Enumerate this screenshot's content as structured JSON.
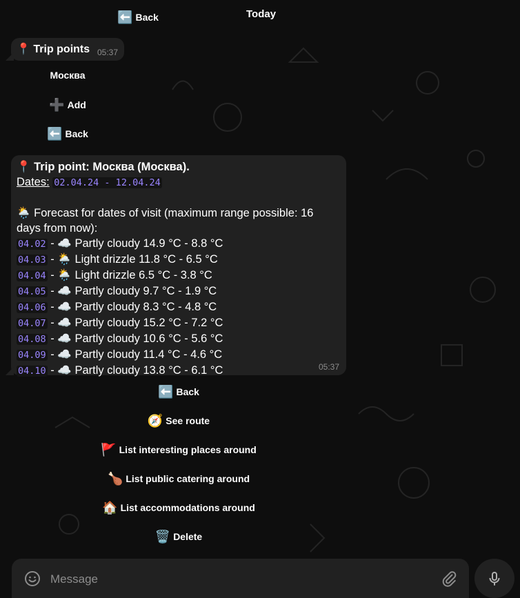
{
  "header": {
    "back_label": "Back",
    "date": "Today"
  },
  "trip_points_msg": {
    "title": "Trip points",
    "time": "05:37"
  },
  "menu1": {
    "city_label": "Москва",
    "add_label": "Add",
    "back_label": "Back"
  },
  "forecast_msg": {
    "line1": "Trip point: Москва (Москва).",
    "dates_label": "Dates:",
    "dates_value": "02.04.24 - 12.04.24",
    "forecast_line1": "Forecast for dates of visit (maximum range possible: 16",
    "forecast_line2": "days from now):",
    "rows": [
      {
        "date": "04.02",
        "icon": "cloud-icon",
        "text": "Partly cloudy 14.9 °C - 8.8 °C"
      },
      {
        "date": "04.03",
        "icon": "rain-cloud-icon",
        "text": "Light drizzle 11.8 °C - 6.5 °C"
      },
      {
        "date": "04.04",
        "icon": "rain-cloud-icon",
        "text": "Light drizzle 6.5 °C - 3.8 °C"
      },
      {
        "date": "04.05",
        "icon": "cloud-icon",
        "text": "Partly cloudy 9.7 °C - 1.9 °C"
      },
      {
        "date": "04.06",
        "icon": "cloud-icon",
        "text": "Partly cloudy 8.3 °C - 4.8 °C"
      },
      {
        "date": "04.07",
        "icon": "cloud-icon",
        "text": "Partly cloudy 15.2 °C - 7.2 °C"
      },
      {
        "date": "04.08",
        "icon": "cloud-icon",
        "text": "Partly cloudy 10.6 °C - 5.6 °C"
      },
      {
        "date": "04.09",
        "icon": "cloud-icon",
        "text": "Partly cloudy 11.4 °C - 4.6 °C"
      },
      {
        "date": "04.10",
        "icon": "cloud-icon",
        "text": "Partly cloudy 13.8 °C - 6.1 °C"
      }
    ],
    "time": "05:37"
  },
  "menu2": {
    "back_label": "Back",
    "route_label": "See route",
    "places_label": "List interesting places around",
    "catering_label": "List public catering around",
    "accommodations_label": "List accommodations around",
    "delete_label": "Delete"
  },
  "composer": {
    "placeholder": "Message"
  },
  "colors": {
    "bubble": "#212121",
    "mono_text": "#9a85ff",
    "background": "#0e0e0e"
  }
}
